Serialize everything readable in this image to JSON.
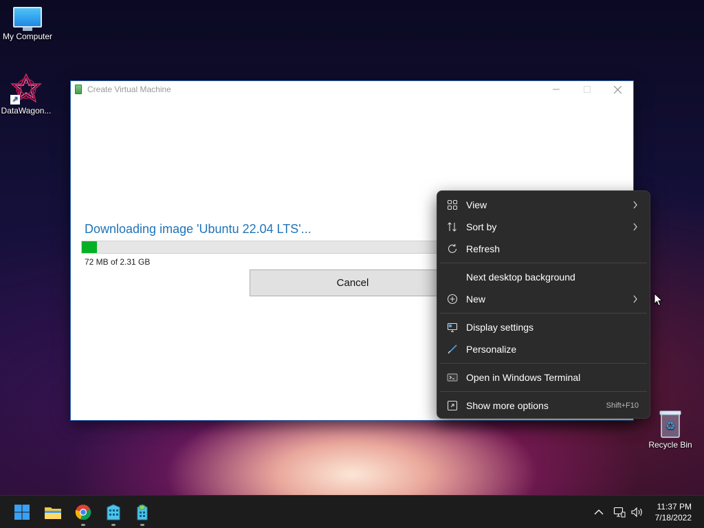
{
  "desktop": {
    "icons": [
      {
        "label": "My Computer"
      },
      {
        "label": "DataWagon..."
      },
      {
        "label": "Recycle Bin"
      }
    ]
  },
  "window": {
    "title": "Create Virtual Machine",
    "download_title": "Downloading image 'Ubuntu 22.04 LTS'...",
    "download_size": "72 MB of 2.31 GB",
    "progress_fraction": 0.031,
    "cancel_label": "Cancel"
  },
  "context_menu": {
    "items": [
      {
        "label": "View",
        "icon": "view-grid-icon",
        "submenu": true
      },
      {
        "label": "Sort by",
        "icon": "sort-icon",
        "submenu": true
      },
      {
        "label": "Refresh",
        "icon": "refresh-icon"
      },
      {
        "label": "Next desktop background"
      },
      {
        "label": "New",
        "icon": "plus-circle-icon",
        "submenu": true
      },
      {
        "label": "Display settings",
        "icon": "display-icon"
      },
      {
        "label": "Personalize",
        "icon": "brush-icon"
      },
      {
        "label": "Open in Windows Terminal",
        "icon": "terminal-icon"
      },
      {
        "label": "Show more options",
        "icon": "more-options-icon",
        "shortcut": "Shift+F10"
      }
    ]
  },
  "taskbar": {
    "apps": [
      "start-icon",
      "file-explorer-icon",
      "chrome-icon",
      "app-building-icon",
      "app-building2-icon"
    ],
    "clock": {
      "time": "11:37 PM",
      "date": "7/18/2022"
    }
  },
  "colors": {
    "accent_blue": "#1f73b7",
    "progress_green": "#06b025",
    "menu_bg": "#2b2b2b",
    "taskbar_bg": "#1c1c1c"
  }
}
